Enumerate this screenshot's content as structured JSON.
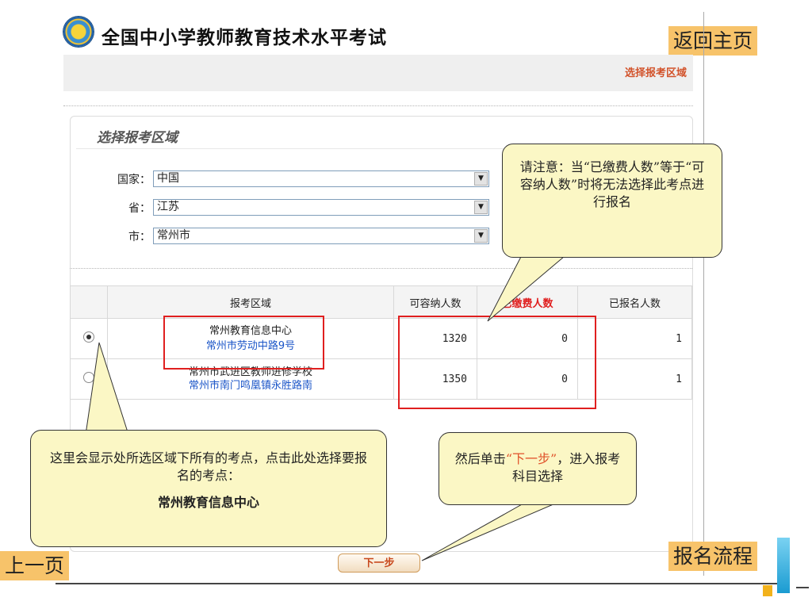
{
  "header": {
    "site_title": "全国中小学教师教育技术水平考试",
    "back_home": "返回主页",
    "step_crumb": "选择报考区域"
  },
  "panel": {
    "title": "选择报考区域",
    "country_label": "国家：",
    "country_value": "中国",
    "province_label": "省：",
    "province_value": "江苏",
    "city_label": "市：",
    "city_value": "常州市",
    "dropdown_icon": "triangle-down"
  },
  "table": {
    "headers": [
      "报考区域",
      "可容纳人数",
      "已缴费人数",
      "已报名人数"
    ],
    "header_highlight_color": "#e01f1f",
    "rows": [
      {
        "name": "常州教育信息中心",
        "address": "常州市劳动中路9号",
        "capacity": "1320",
        "paid": "0",
        "registered": "1",
        "selected": true
      },
      {
        "name": "常州市武进区教师进修学校",
        "address": "常州市南门鸣凰镇永胜路南",
        "capacity": "1350",
        "paid": "0",
        "registered": "1",
        "selected": false
      }
    ]
  },
  "callouts": {
    "notice": "请注意：当“已缴费人数”等于“可容纳人数”时将无法选择此考点进行报名",
    "select_hint": "这里会显示处所选区域下所有的考点，点击此处选择要报名的考点：",
    "select_hint_bold": "常州教育信息中心",
    "next_prefix": "然后单击",
    "next_highlight": "“下一步”",
    "next_suffix": "，进入报考科目选择"
  },
  "buttons": {
    "next": "下一步"
  },
  "nav": {
    "prev_page": "上一页",
    "process": "报名流程"
  },
  "colors": {
    "accent_orange": "#f7c36a",
    "crumb_orange": "#d2522a",
    "highlight_red": "#e01f1f",
    "address_blue": "#1c56c8",
    "callout_fill": "#fbf7c5"
  }
}
